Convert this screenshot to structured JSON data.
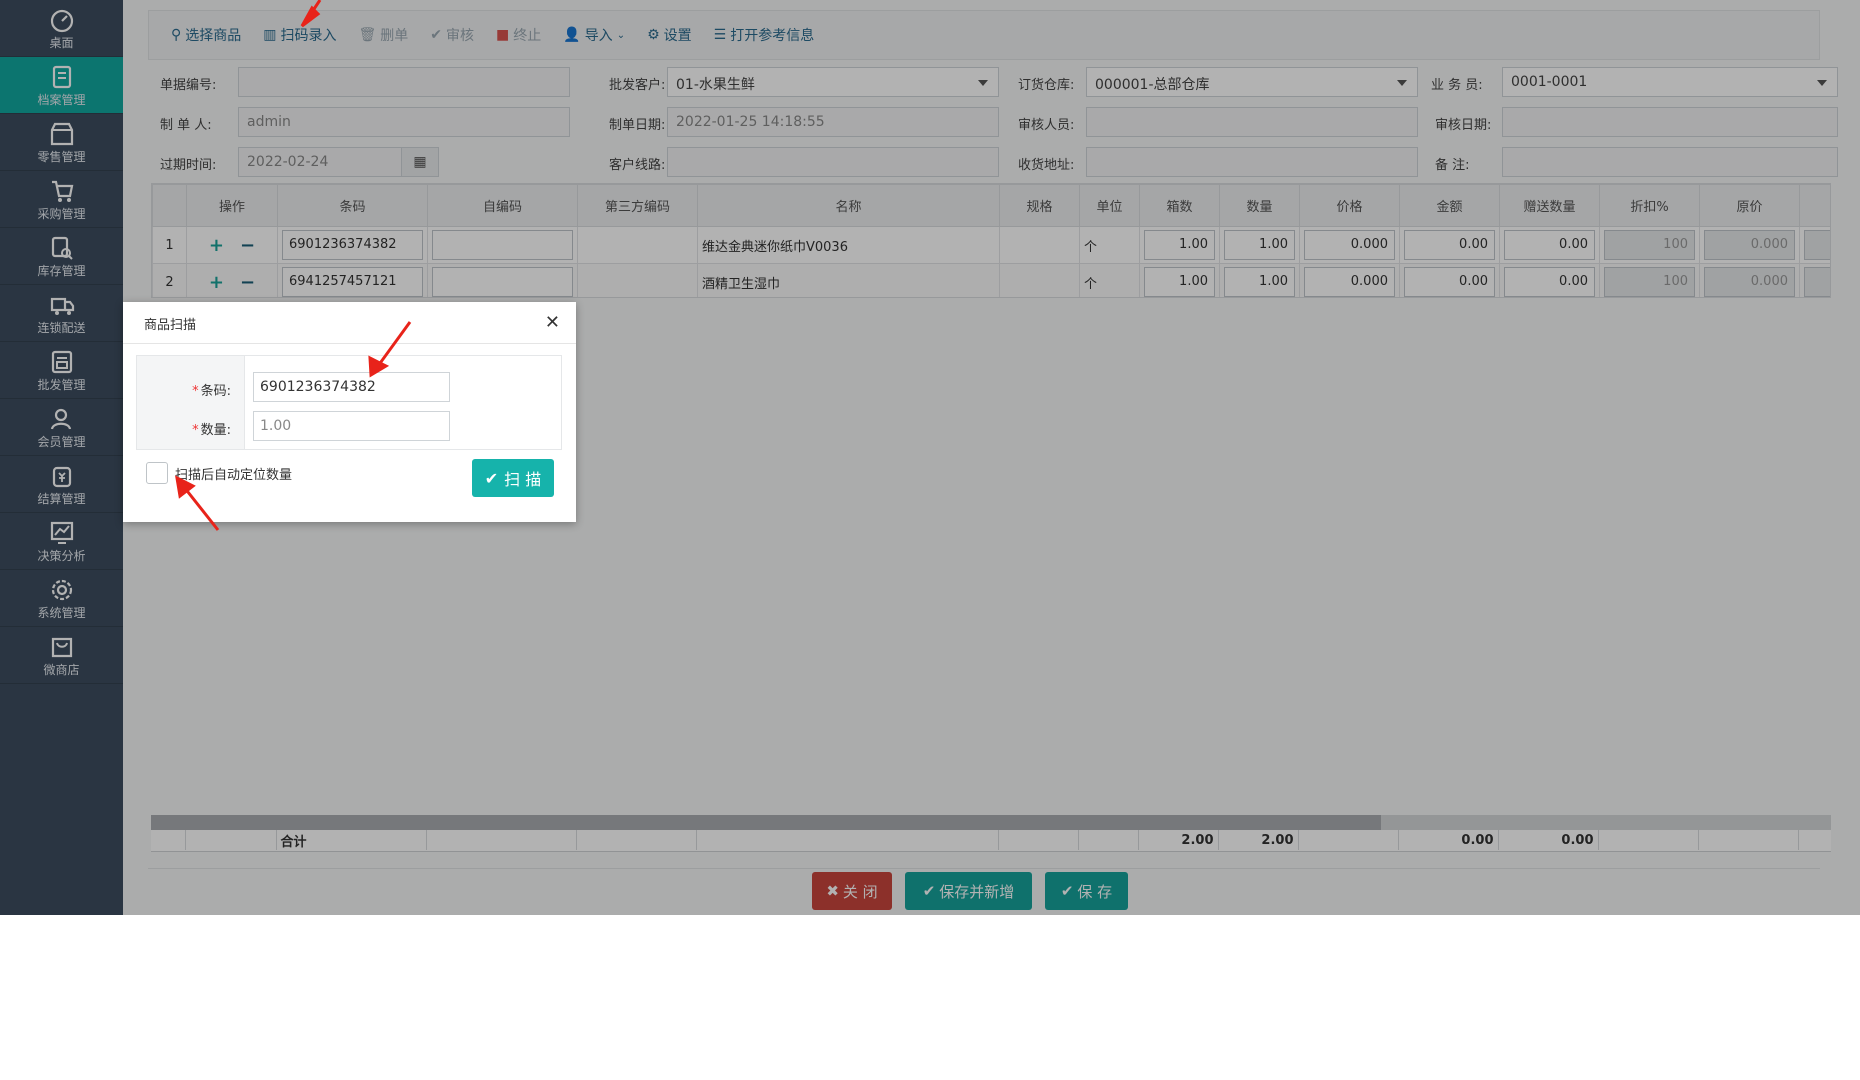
{
  "sidebar": {
    "items": [
      {
        "label": "桌面",
        "icon": "dashboard-icon",
        "active": false
      },
      {
        "label": "档案管理",
        "icon": "archive-icon",
        "active": true
      },
      {
        "label": "零售管理",
        "icon": "store-icon",
        "active": false
      },
      {
        "label": "采购管理",
        "icon": "purchase-icon",
        "active": false
      },
      {
        "label": "库存管理",
        "icon": "inventory-icon",
        "active": false
      },
      {
        "label": "连锁配送",
        "icon": "delivery-icon",
        "active": false
      },
      {
        "label": "批发管理",
        "icon": "wholesale-icon",
        "active": false
      },
      {
        "label": "会员管理",
        "icon": "member-icon",
        "active": false
      },
      {
        "label": "结算管理",
        "icon": "settlement-icon",
        "active": false
      },
      {
        "label": "决策分析",
        "icon": "analysis-icon",
        "active": false
      },
      {
        "label": "系统管理",
        "icon": "settings-icon",
        "active": false
      },
      {
        "label": "微商店",
        "icon": "shop-icon",
        "active": false
      }
    ]
  },
  "toolbar": {
    "select_goods": "选择商品",
    "scan_entry": "扫码录入",
    "delete": "删单",
    "audit": "审核",
    "terminate": "终止",
    "import": "导入",
    "settings": "设置",
    "open_ref": "打开参考信息"
  },
  "form": {
    "doc_no_label": "单据编号:",
    "doc_no": "",
    "customer_label": "批发客户:",
    "customer": "01-水果生鲜",
    "warehouse_label": "订货仓库:",
    "warehouse": "000001-总部仓库",
    "salesman_label": "业 务 员:",
    "salesman": "0001-0001",
    "maker_label": "制 单 人:",
    "maker": "admin",
    "make_date_label": "制单日期:",
    "make_date": "2022-01-25 14:18:55",
    "auditor_label": "审核人员:",
    "auditor": "",
    "audit_date_label": "审核日期:",
    "audit_date": "",
    "expire_label": "过期时间:",
    "expire": "2022-02-24",
    "route_label": "客户线路:",
    "route": "",
    "address_label": "收货地址:",
    "address": "",
    "remark_label": "备 注:",
    "remark": ""
  },
  "grid": {
    "headers": [
      "",
      "操作",
      "条码",
      "自编码",
      "第三方编码",
      "名称",
      "规格",
      "单位",
      "箱数",
      "数量",
      "价格",
      "金额",
      "赠送数量",
      "折扣%",
      "原价",
      ""
    ],
    "rows": [
      {
        "no": "1",
        "barcode": "6901236374382",
        "selfcode": "",
        "thirdcode": "",
        "name": "维达金典迷你纸巾V0036",
        "spec": "",
        "unit": "个",
        "boxes": "1.00",
        "qty": "1.00",
        "price": "0.000",
        "amount": "0.00",
        "gift": "0.00",
        "discount": "100",
        "orig": "0.000"
      },
      {
        "no": "2",
        "barcode": "6941257457121",
        "selfcode": "",
        "thirdcode": "",
        "name": "酒精卫生湿巾",
        "spec": "",
        "unit": "个",
        "boxes": "1.00",
        "qty": "1.00",
        "price": "0.000",
        "amount": "0.00",
        "gift": "0.00",
        "discount": "100",
        "orig": "0.000"
      }
    ],
    "totals": {
      "label": "合计",
      "boxes": "2.00",
      "qty": "2.00",
      "amount": "0.00",
      "gift": "0.00"
    }
  },
  "buttons": {
    "close": "关 闭",
    "save_new": "保存并新增",
    "save": "保 存"
  },
  "dialog": {
    "title": "商品扫描",
    "barcode_label": "条码:",
    "barcode_value": "6901236374382",
    "qty_label": "数量:",
    "qty_placeholder": "1.00",
    "auto_locate_label": "扫描后自动定位数量",
    "scan_button": "扫 描"
  },
  "colors": {
    "sidebar_bg": "#3d4d5f",
    "accent": "#16b3ab",
    "danger": "#c9463d",
    "annotation_arrow": "#e8231a"
  }
}
